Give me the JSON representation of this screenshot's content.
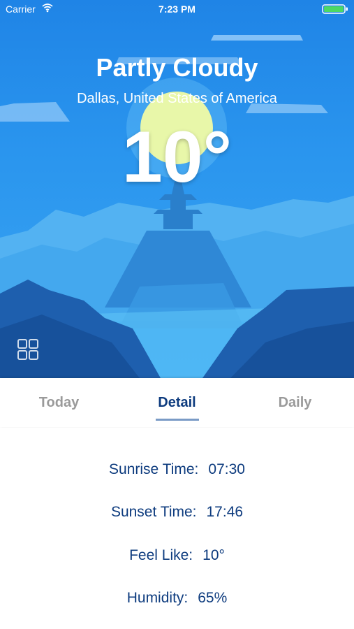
{
  "status_bar": {
    "carrier": "Carrier",
    "time": "7:23 PM"
  },
  "weather": {
    "condition": "Partly Cloudy",
    "location": "Dallas, United States of America",
    "temperature": "10°"
  },
  "tabs": [
    {
      "label": "Today",
      "active": false
    },
    {
      "label": "Detail",
      "active": true
    },
    {
      "label": "Daily",
      "active": false
    }
  ],
  "details": [
    {
      "label": "Sunrise Time:",
      "value": "07:30"
    },
    {
      "label": "Sunset Time:",
      "value": "17:46"
    },
    {
      "label": "Feel Like:",
      "value": "10°"
    },
    {
      "label": "Humidity:",
      "value": "65%"
    }
  ],
  "icons": {
    "wifi": "wifi-icon",
    "battery": "battery-icon",
    "grid": "grid-icon"
  },
  "colors": {
    "accent_text": "#0d3b7e",
    "inactive_tab": "#9a9a9a",
    "sky": "#2a95ee",
    "battery_fill": "#4cd964"
  }
}
